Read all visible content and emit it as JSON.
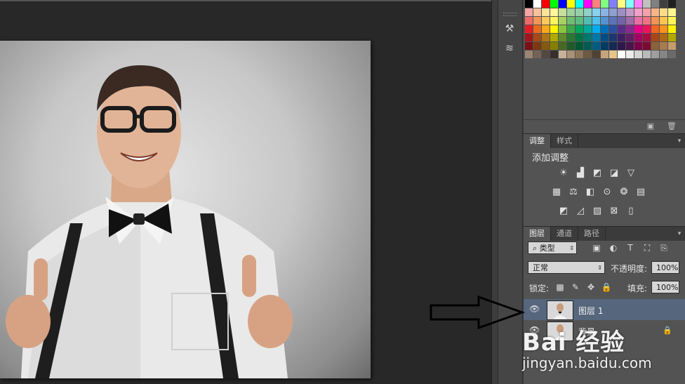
{
  "swatches": [
    [
      "#000000",
      "#ffffff",
      "#ff0000",
      "#00ff00",
      "#0000ff",
      "#ffff00",
      "#00ffff",
      "#ff00ff",
      "#ff8080",
      "#80ff80",
      "#8080ff",
      "#ffff80",
      "#80ffff",
      "#ff80ff",
      "#c0c0c0",
      "#808080",
      "#404040",
      "#202020"
    ],
    [
      "#f5a3a3",
      "#f7c29a",
      "#fbe39a",
      "#fff799",
      "#c6e09a",
      "#9ed29e",
      "#94cfa8",
      "#8fd0c9",
      "#89d2ef",
      "#8ab4e3",
      "#8e9fd1",
      "#9d8fc6",
      "#c39bc6",
      "#f1a0c7",
      "#f3a2a9",
      "#f8b58a",
      "#fddc89",
      "#fff68f"
    ],
    [
      "#ec6a6a",
      "#f19659",
      "#f9c95b",
      "#fff45f",
      "#a7d063",
      "#70bc71",
      "#5dba80",
      "#52bcb2",
      "#4ec0ea",
      "#5592d1",
      "#5d73b9",
      "#7364a9",
      "#9f6ba9",
      "#e770a6",
      "#ef7383",
      "#f39354",
      "#f8c650",
      "#fff35a"
    ],
    [
      "#e31d24",
      "#ea6b1f",
      "#f5a81c",
      "#fff200",
      "#89c440",
      "#3aaa48",
      "#00a560",
      "#00a99d",
      "#00aeef",
      "#0070bb",
      "#2b4fa2",
      "#5a2d8c",
      "#8b288f",
      "#e7008c",
      "#ed145b",
      "#f26522",
      "#f7941d",
      "#fff200"
    ],
    [
      "#a0161b",
      "#a54a17",
      "#ad7614",
      "#b1a900",
      "#608b2d",
      "#2a7833",
      "#007443",
      "#007770",
      "#0079a8",
      "#004e85",
      "#1d3671",
      "#3f1f64",
      "#621d65",
      "#a30062",
      "#a60d40",
      "#aa4619",
      "#ae6914",
      "#b1a900"
    ],
    [
      "#7a1014",
      "#7e3811",
      "#845a0e",
      "#877f00",
      "#496923",
      "#1f5b27",
      "#005833",
      "#005b55",
      "#005c80",
      "#003b64",
      "#162856",
      "#30174c",
      "#4a154d",
      "#7c004b",
      "#7e0a31",
      "#8c6239",
      "#a67c52",
      "#c69c6d"
    ],
    [
      "#998675",
      "#736357",
      "#534741",
      "#362f2d",
      "#c7b299",
      "#a79276",
      "#8b7659",
      "#6c5a43",
      "#4f4232",
      "#c4a57b",
      "#e6c58b",
      "#ffffff",
      "#ebebeb",
      "#d4d4d4",
      "#bababa",
      "#9e9e9e",
      "#858585",
      "#6b6b6b"
    ]
  ],
  "adjust_panel": {
    "tabs": [
      {
        "label": "调整"
      },
      {
        "label": "样式"
      }
    ],
    "title": "添加调整"
  },
  "layers_panel": {
    "tabs": [
      {
        "label": "图层"
      },
      {
        "label": "通道"
      },
      {
        "label": "路径"
      }
    ],
    "filter_kind": "类型",
    "blend_mode": "正常",
    "opacity_label": "不透明度:",
    "opacity_value": "100%",
    "lock_label": "锁定:",
    "fill_label": "填充:",
    "fill_value": "100%",
    "layers": [
      {
        "name": "图层 1",
        "selected": true,
        "locked": false
      },
      {
        "name": "背景",
        "selected": false,
        "locked": true
      }
    ]
  },
  "watermark": {
    "logo": "Bai 经验",
    "url": "jingyan.baidu.com"
  }
}
